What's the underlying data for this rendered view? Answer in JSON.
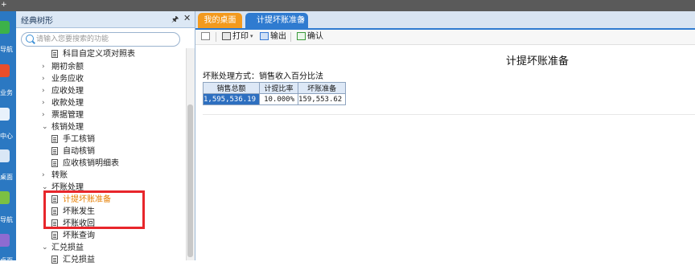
{
  "window": {
    "corner_glyph": "+"
  },
  "left_rail": {
    "items": [
      "导航",
      "业务",
      "中心",
      "桌面",
      "导航",
      "桌面"
    ]
  },
  "side_panel": {
    "title": "经典树形",
    "search_placeholder": "请输入您要搜索的功能",
    "tree": [
      {
        "label": "科目自定义项对照表",
        "kind": "leaf",
        "level": 2
      },
      {
        "label": "期初余额",
        "kind": "folder",
        "state": "collapsed"
      },
      {
        "label": "业务应收",
        "kind": "folder",
        "state": "collapsed"
      },
      {
        "label": "应收处理",
        "kind": "folder",
        "state": "collapsed"
      },
      {
        "label": "收款处理",
        "kind": "folder",
        "state": "collapsed"
      },
      {
        "label": "票据管理",
        "kind": "folder",
        "state": "collapsed"
      },
      {
        "label": "核销处理",
        "kind": "folder",
        "state": "expanded"
      },
      {
        "label": "手工核销",
        "kind": "leaf",
        "level": 2
      },
      {
        "label": "自动核销",
        "kind": "leaf",
        "level": 2
      },
      {
        "label": "应收核销明细表",
        "kind": "leaf",
        "level": 2
      },
      {
        "label": "转账",
        "kind": "folder",
        "state": "collapsed"
      },
      {
        "label": "坏账处理",
        "kind": "folder",
        "state": "expanded"
      },
      {
        "label": "计提坏账准备",
        "kind": "leaf",
        "level": 2,
        "highlighted": true
      },
      {
        "label": "坏账发生",
        "kind": "leaf",
        "level": 2
      },
      {
        "label": "坏账收回",
        "kind": "leaf",
        "level": 2
      },
      {
        "label": "坏账查询",
        "kind": "leaf",
        "level": 2
      },
      {
        "label": "汇兑损益",
        "kind": "folder",
        "state": "expanded"
      },
      {
        "label": "汇兑损益",
        "kind": "leaf",
        "level": 2
      }
    ]
  },
  "tabs": {
    "home": "我的桌面",
    "active": "计提坏账准备"
  },
  "toolbar": {
    "print": "打印",
    "export": "输出",
    "confirm": "确认"
  },
  "report": {
    "title": "计提坏账准备",
    "method": "坏账处理方式：销售收入百分比法",
    "columns": [
      "销售总额",
      "计提比率",
      "坏账准备"
    ],
    "rows": [
      [
        "1,595,536.19",
        "10.000%",
        "159,553.62"
      ]
    ]
  },
  "colors": {
    "accent_blue": "#2f7bd0",
    "home_tab_orange": "#f39a1e",
    "highlight_text": "#e67e00",
    "annotation_red": "#e8262b",
    "selected_cell": "#2d6fc0"
  }
}
